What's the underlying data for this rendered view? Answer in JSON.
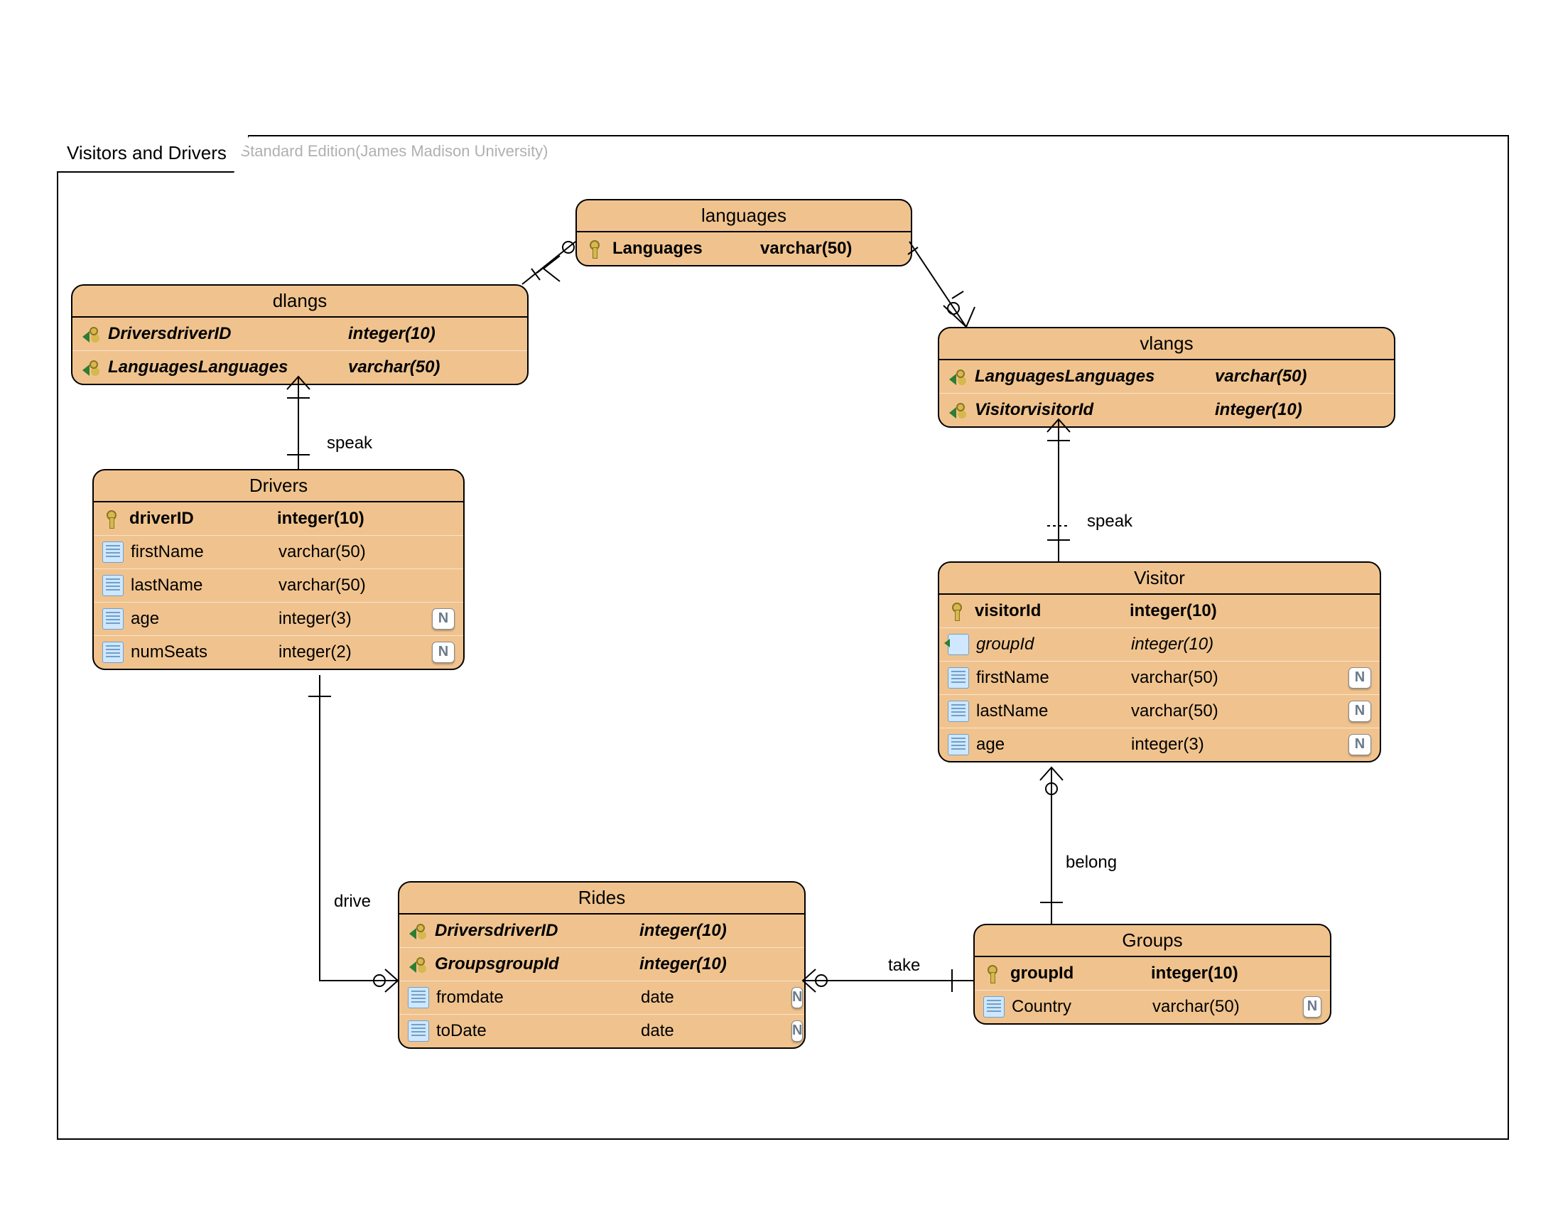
{
  "watermark": "Visual Paradigm for UML Standard Edition(James Madison University)",
  "frame_title": "Visitors and Drivers",
  "relations": {
    "speak1": "speak",
    "speak2": "speak",
    "drive": "drive",
    "take": "take",
    "belong": "belong"
  },
  "entities": {
    "languages": {
      "title": "languages",
      "cols": [
        {
          "name": "Languages",
          "type": "varchar(50)",
          "icon": "pk",
          "bold": true
        }
      ]
    },
    "dlangs": {
      "title": "dlangs",
      "cols": [
        {
          "name": "DriversdriverID",
          "type": "integer(10)",
          "icon": "fk",
          "bold": true,
          "italic": true
        },
        {
          "name": "LanguagesLanguages",
          "type": "varchar(50)",
          "icon": "fk",
          "bold": true,
          "italic": true
        }
      ]
    },
    "vlangs": {
      "title": "vlangs",
      "cols": [
        {
          "name": "LanguagesLanguages",
          "type": "varchar(50)",
          "icon": "fk",
          "bold": true,
          "italic": true
        },
        {
          "name": "VisitorvisitorId",
          "type": "integer(10)",
          "icon": "fk",
          "bold": true,
          "italic": true
        }
      ]
    },
    "drivers": {
      "title": "Drivers",
      "cols": [
        {
          "name": "driverID",
          "type": "integer(10)",
          "icon": "pk",
          "bold": true
        },
        {
          "name": "firstName",
          "type": "varchar(50)",
          "icon": "col"
        },
        {
          "name": "lastName",
          "type": "varchar(50)",
          "icon": "col"
        },
        {
          "name": "age",
          "type": "integer(3)",
          "icon": "col",
          "nullable": true
        },
        {
          "name": "numSeats",
          "type": "integer(2)",
          "icon": "col",
          "nullable": true
        }
      ]
    },
    "visitor": {
      "title": "Visitor",
      "cols": [
        {
          "name": "visitorId",
          "type": "integer(10)",
          "icon": "pk",
          "bold": true
        },
        {
          "name": "groupId",
          "type": "integer(10)",
          "icon": "fkcol",
          "italic": true
        },
        {
          "name": "firstName",
          "type": "varchar(50)",
          "icon": "col",
          "nullable": true
        },
        {
          "name": "lastName",
          "type": "varchar(50)",
          "icon": "col",
          "nullable": true
        },
        {
          "name": "age",
          "type": "integer(3)",
          "icon": "col",
          "nullable": true
        }
      ]
    },
    "rides": {
      "title": "Rides",
      "cols": [
        {
          "name": "DriversdriverID",
          "type": "integer(10)",
          "icon": "fk",
          "bold": true,
          "italic": true
        },
        {
          "name": "GroupsgroupId",
          "type": "integer(10)",
          "icon": "fk",
          "bold": true,
          "italic": true
        },
        {
          "name": "fromdate",
          "type": "date",
          "icon": "col",
          "nullable": true
        },
        {
          "name": "toDate",
          "type": "date",
          "icon": "col",
          "nullable": true
        }
      ]
    },
    "groups": {
      "title": "Groups",
      "cols": [
        {
          "name": "groupId",
          "type": "integer(10)",
          "icon": "pk",
          "bold": true
        },
        {
          "name": "Country",
          "type": "varchar(50)",
          "icon": "col",
          "nullable": true
        }
      ]
    }
  }
}
